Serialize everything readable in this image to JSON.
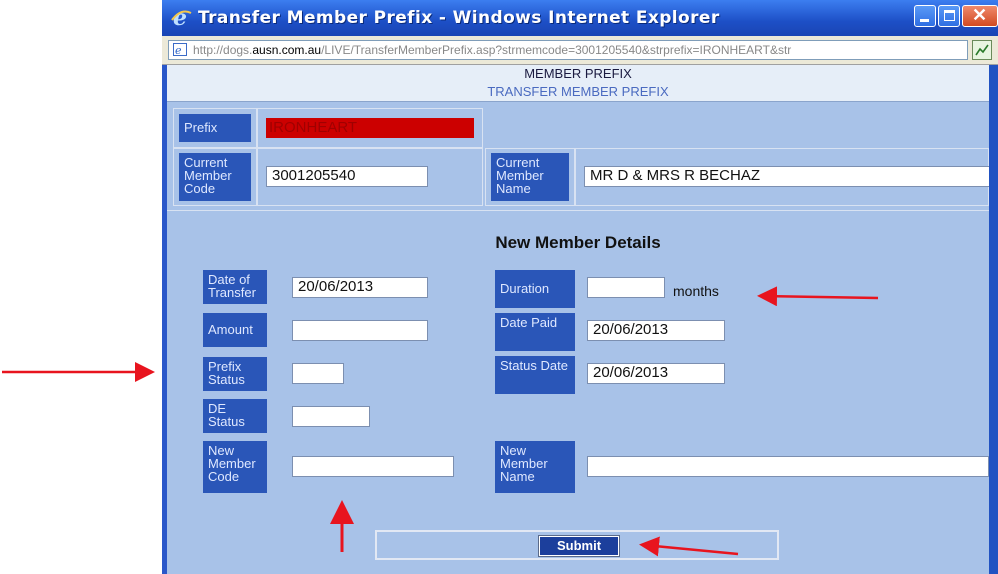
{
  "window": {
    "title": "Transfer Member Prefix - Windows Internet Explorer",
    "url_prefix": "http://dogs.",
    "url_domain": "ausn.com.au",
    "url_suffix": "/LIVE/TransferMemberPrefix.asp?strmemcode=3001205540&strprefix=IRONHEART&str"
  },
  "header": {
    "line1": "MEMBER PREFIX",
    "line2": "TRANSFER MEMBER PREFIX"
  },
  "current": {
    "prefix_label": "Prefix",
    "prefix_value": "IRONHEART",
    "code_label": "Current Member Code",
    "code_value": "3001205540",
    "name_label": "Current Member Name",
    "name_value": "MR D & MRS R BECHAZ"
  },
  "details": {
    "title": "New Member Details",
    "date_of_transfer_label": "Date of Transfer",
    "date_of_transfer_value": "20/06/2013",
    "duration_label": "Duration",
    "duration_value": "",
    "duration_unit": "months",
    "amount_label": "Amount",
    "amount_value": "",
    "date_paid_label": "Date Paid",
    "date_paid_value": "20/06/2013",
    "prefix_status_label": "Prefix Status",
    "prefix_status_value": "",
    "status_date_label": "Status Date",
    "status_date_value": "20/06/2013",
    "de_status_label": "DE Status",
    "de_status_value": "",
    "new_code_label": "New Member Code",
    "new_code_value": "",
    "new_name_label": "New Member Name",
    "new_name_value": ""
  },
  "submit_label": "Submit",
  "colors": {
    "annotation_arrow": "#e8141e",
    "label_bg": "#2a56b8",
    "page_bg": "#a8c2e8",
    "prefix_field_bg": "#cc0000"
  }
}
